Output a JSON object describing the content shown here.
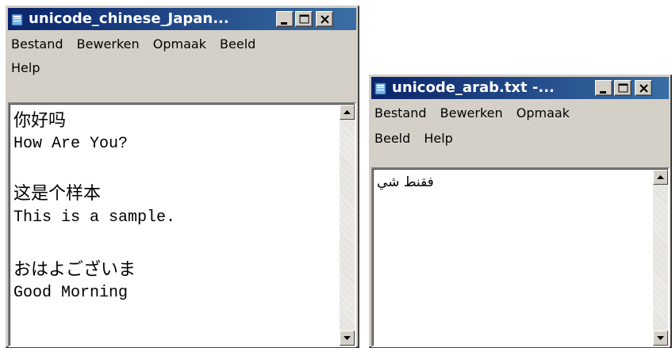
{
  "windows": {
    "left": {
      "title": "unicode_chinese_Japan...",
      "menu": [
        "Bestand",
        "Bewerken",
        "Opmaak",
        "Beeld",
        "Help"
      ],
      "lines": [
        "你好吗",
        "How Are You?",
        "这是个样本",
        "This is a sample.",
        "おはよございま",
        "Good Morning"
      ]
    },
    "right": {
      "title": "unicode_arab.txt -...",
      "menu": [
        "Bestand",
        "Bewerken",
        "Opmaak",
        "Beeld",
        "Help"
      ],
      "lines": [
        "فقنط شي"
      ]
    }
  },
  "colors": {
    "titlebar_start": "#0a246a",
    "titlebar_end": "#3a6ea5",
    "window_face": "#d4d0c8"
  },
  "icons": {
    "app": "notepad-icon",
    "minimize": "minimize-icon",
    "maximize": "maximize-icon",
    "close": "close-icon",
    "scroll_up": "scroll-up-arrow-icon",
    "scroll_down": "scroll-down-arrow-icon"
  }
}
